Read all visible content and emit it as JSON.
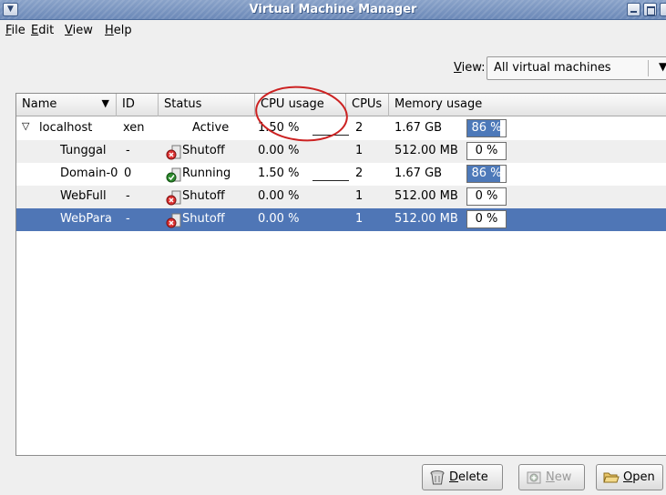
{
  "window": {
    "title": "Virtual Machine Manager"
  },
  "menu": [
    {
      "underline": "F",
      "rest": "ile"
    },
    {
      "underline": "E",
      "rest": "dit"
    },
    {
      "underline": "V",
      "rest": "iew"
    },
    {
      "underline": "H",
      "rest": "elp"
    }
  ],
  "view_selector": {
    "label_underline": "V",
    "label_rest": "iew:",
    "value": "All virtual machines"
  },
  "columns": {
    "name": "Name",
    "id": "ID",
    "status": "Status",
    "cpu": "CPU usage",
    "cpus": "CPUs",
    "memory": "Memory usage"
  },
  "rows": [
    {
      "name": "localhost",
      "id": "xen",
      "status": "Active",
      "cpu": "1.50 %",
      "cpus": "2",
      "mem": "1.67 GB",
      "mem_pct": "86 %",
      "mem_frac": 0.86
    },
    {
      "name": "Tunggal",
      "id": "-",
      "status": "Shutoff",
      "cpu": "0.00 %",
      "cpus": "1",
      "mem": "512.00 MB",
      "mem_pct": "0 %",
      "mem_frac": 0.0
    },
    {
      "name": "Domain-0",
      "id": "0",
      "status": "Running",
      "cpu": "1.50 %",
      "cpus": "2",
      "mem": "1.67 GB",
      "mem_pct": "86 %",
      "mem_frac": 0.86
    },
    {
      "name": "WebFull",
      "id": "-",
      "status": "Shutoff",
      "cpu": "0.00 %",
      "cpus": "1",
      "mem": "512.00 MB",
      "mem_pct": "0 %",
      "mem_frac": 0.0
    },
    {
      "name": "WebPara",
      "id": "-",
      "status": "Shutoff",
      "cpu": "0.00 %",
      "cpus": "1",
      "mem": "512.00 MB",
      "mem_pct": "0 %",
      "mem_frac": 0.0
    }
  ],
  "buttons": {
    "delete": {
      "underline": "D",
      "rest": "elete"
    },
    "new": {
      "underline": "N",
      "rest": "ew"
    },
    "open": {
      "underline": "O",
      "rest": "pen"
    }
  },
  "colors": {
    "selection": "#4f76b6",
    "memory_bar": "#4d79b9",
    "annotation": "#cc2222"
  }
}
